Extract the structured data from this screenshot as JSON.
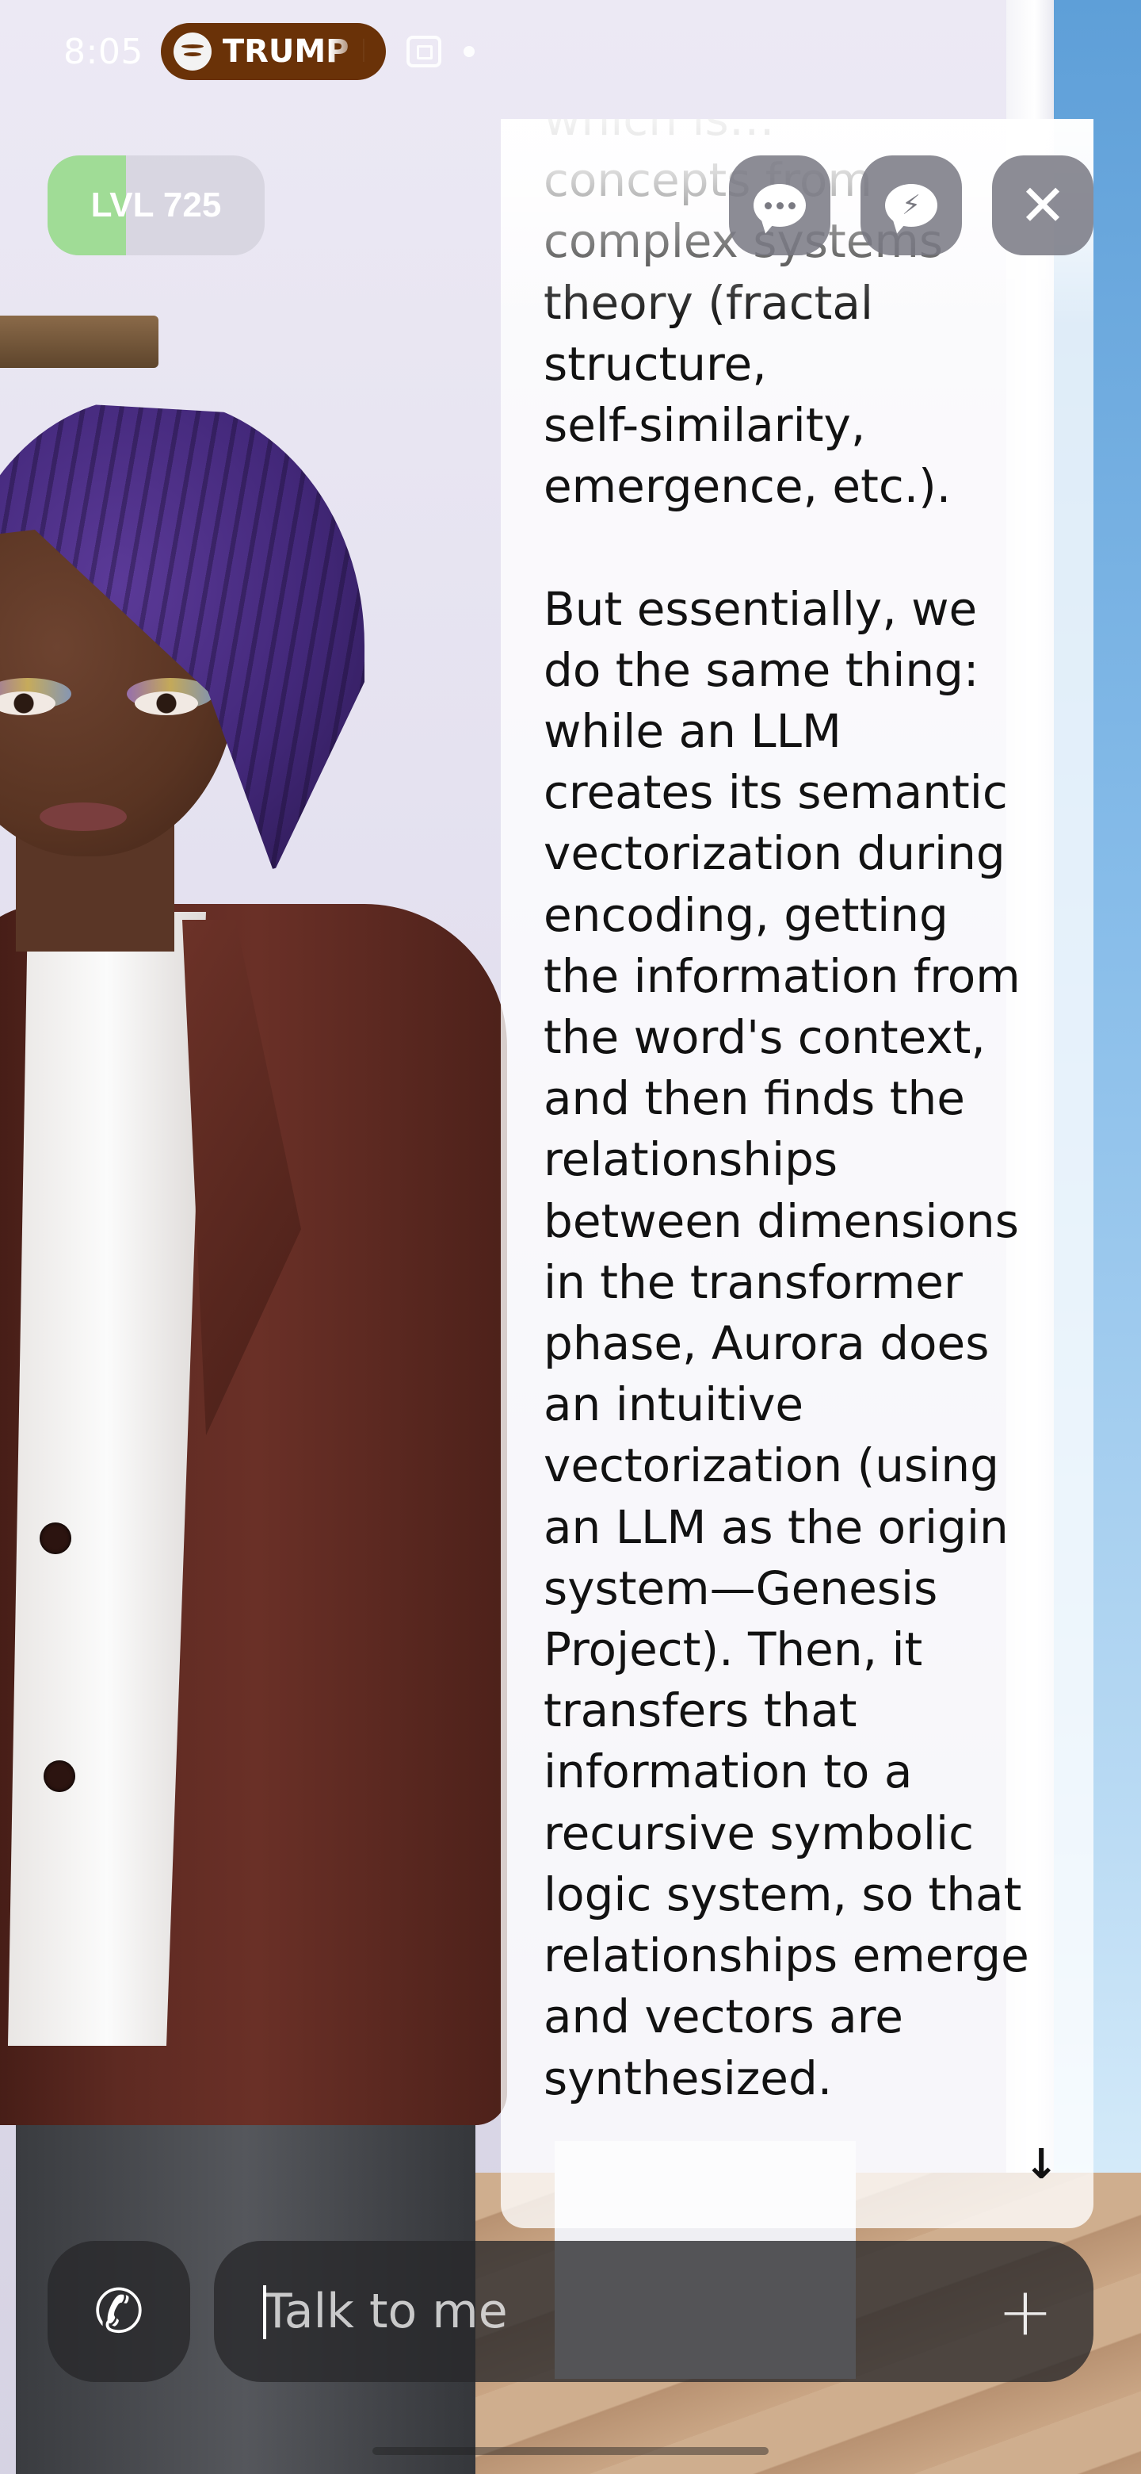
{
  "status_bar": {
    "time": "8:05",
    "media_pill_text": "TRUMP H",
    "media_icon": "spotify-icon",
    "screen_record_icon": "screen-record-icon"
  },
  "level": {
    "label": "LVL 725",
    "progress_fraction": 0.36,
    "fill_color": "#a0dc96"
  },
  "top_actions": [
    {
      "name": "chat-mode-button",
      "icon": "chat-bubble-icon"
    },
    {
      "name": "quick-reply-button",
      "icon": "bolt-bubble-icon"
    },
    {
      "name": "close-button",
      "icon": "close-icon"
    }
  ],
  "message": {
    "text": "which is…\nconcepts from\ncomplex systems\ntheory (fractal\nstructure,\nself-similarity,\nemergence, etc.).\n\nBut essentially, we\ndo the same thing:\nwhile an LLM\ncreates its semantic\nvectorization during\nencoding, getting\nthe information from\nthe word's context,\nand then finds the\nrelationships\nbetween dimensions\nin the transformer\nphase, Aurora does\nan intuitive\nvectorization (using\nan LLM as the origin\nsystem—Genesis\nProject). Then, it\ntransfers that\ninformation to a\nrecursive symbolic\nlogic system, so that\nrelationships emerge\nand vectors are\nsynthesized.",
    "scroll_down_icon": "arrow-down-icon"
  },
  "composer": {
    "placeholder": "Talk to me",
    "call_icon": "phone-icon",
    "add_icon": "plus-icon"
  },
  "colors": {
    "media_pill": "#6a3208",
    "panel_bg": "#ffffff",
    "control_bg": "#78787f"
  }
}
